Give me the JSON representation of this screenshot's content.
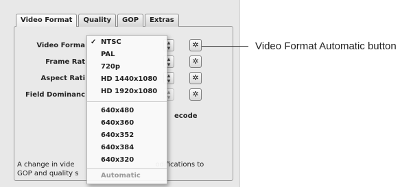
{
  "tabs": [
    {
      "label": "Video Format",
      "active": true
    },
    {
      "label": "Quality",
      "active": false
    },
    {
      "label": "GOP",
      "active": false
    },
    {
      "label": "Extras",
      "active": false
    }
  ],
  "fields": [
    {
      "label": "Video Forma"
    },
    {
      "label": "Frame Rat"
    },
    {
      "label": "Aspect Rati"
    },
    {
      "label": "Field Dominanc"
    }
  ],
  "menu": {
    "selected": "NTSC",
    "check_glyph": "✓",
    "items": [
      "NTSC",
      "PAL",
      "720p",
      "HD 1440x1080",
      "HD 1920x1080",
      "640x480",
      "640x360",
      "640x352",
      "640x384",
      "640x320",
      "Automatic"
    ]
  },
  "timecode_label": "ecode",
  "note": {
    "line1_left": "A change in vide",
    "line1_right": "odifications to",
    "line2_left": "GOP and quality s"
  },
  "callout": {
    "text": "Video Format Automatic button"
  },
  "icons": {
    "auto_button": "gear-icon",
    "stepper": "up-down-arrows-icon"
  }
}
